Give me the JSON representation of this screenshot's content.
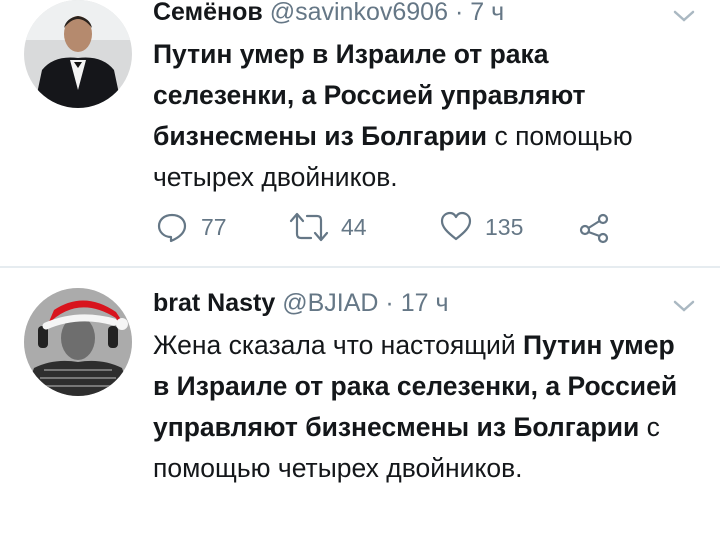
{
  "tweets": [
    {
      "name": "Семёнов",
      "handle": "@savinkov6906",
      "sep": "·",
      "time": "7 ч",
      "text_parts": [
        {
          "bold": true,
          "text": "Путин умер в Израиле от рака селезенки, а Россией управляют бизнесмены из Болгарии"
        },
        {
          "bold": false,
          "text": " с помощью четырех двойников."
        }
      ],
      "replies": "77",
      "retweets": "44",
      "likes": "135"
    },
    {
      "name": "brat Nasty",
      "handle": "@BJIAD",
      "sep": "·",
      "time": "17 ч",
      "text_parts": [
        {
          "bold": false,
          "text": "Жена сказала что настоящий "
        },
        {
          "bold": true,
          "text": "Путин умер в Израиле от рака селезенки, а Россией управляют бизнесмены из Болгарии"
        },
        {
          "bold": false,
          "text": " с помощью четырех двойников."
        }
      ]
    }
  ],
  "colors": {
    "text": "#14171a",
    "meta": "#657786",
    "divider": "#e6ecf0"
  },
  "icons": [
    "reply-icon",
    "retweet-icon",
    "like-icon",
    "share-icon",
    "chevron-down-icon"
  ]
}
